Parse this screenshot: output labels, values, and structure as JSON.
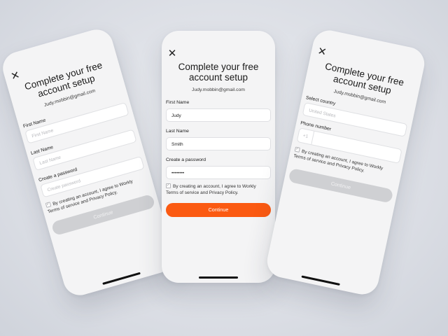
{
  "common": {
    "close_glyph": "✕",
    "title": "Complete your free account setup",
    "email": "Judy.mobbin@gmail.com",
    "consent": "By creating an account, I agree to Workly Terms of service and Privacy Policy.",
    "continue_label": "Continue"
  },
  "left_screen": {
    "first_name_label": "First Name",
    "first_name_placeholder": "First Name",
    "last_name_label": "Last Name",
    "last_name_placeholder": "Last Name",
    "password_label": "Create a password",
    "password_placeholder": "Create password"
  },
  "center_screen": {
    "first_name_label": "First Name",
    "first_name_value": "Judy",
    "last_name_label": "Last Name",
    "last_name_value": "Smith",
    "password_label": "Create a password",
    "password_value": "••••••••"
  },
  "right_screen": {
    "country_label": "Select country",
    "country_placeholder": "United States",
    "phone_label": "Phone number",
    "dial_code": "+1"
  },
  "colors": {
    "primary": "#fb5a12",
    "disabled": "#cfd0d3"
  }
}
